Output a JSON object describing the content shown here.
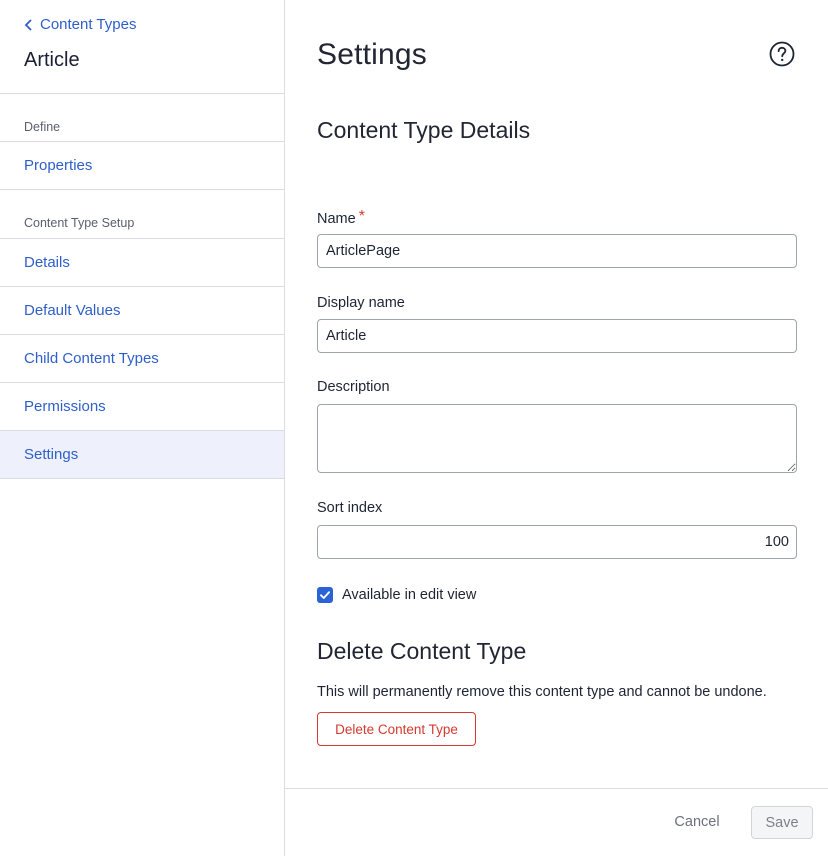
{
  "sidebar": {
    "back_label": "Content Types",
    "title": "Article",
    "section_define": "Define",
    "section_setup": "Content Type Setup",
    "items": [
      {
        "label": "Properties"
      },
      {
        "label": "Details"
      },
      {
        "label": "Default Values"
      },
      {
        "label": "Child Content Types"
      },
      {
        "label": "Permissions"
      },
      {
        "label": "Settings",
        "active": true
      }
    ]
  },
  "main": {
    "title": "Settings",
    "help_icon": "question-circle-icon",
    "details_heading": "Content Type Details",
    "fields": {
      "name": {
        "label": "Name",
        "required_mark": "*",
        "value": "ArticlePage"
      },
      "display_name": {
        "label": "Display name",
        "value": "Article"
      },
      "description": {
        "label": "Description",
        "value": ""
      },
      "sort_index": {
        "label": "Sort index",
        "value": "100"
      }
    },
    "available_in_edit_view": {
      "label": "Available in edit view",
      "checked": true
    },
    "delete_heading": "Delete Content Type",
    "delete_description": "This will permanently remove this content type and cannot be undone.",
    "delete_button": "Delete Content Type"
  },
  "footer": {
    "cancel_label": "Cancel",
    "save_label": "Save"
  },
  "colors": {
    "link": "#2e5fc9",
    "danger": "#d43a2f",
    "checkbox": "#2a63d6",
    "active_nav_bg": "#eef1fb"
  }
}
